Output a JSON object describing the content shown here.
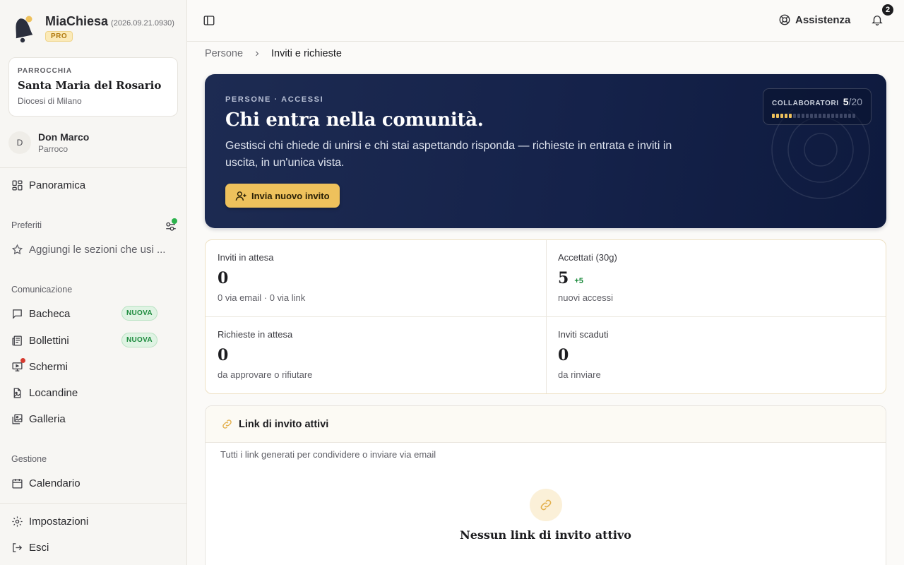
{
  "app": {
    "name": "MiaChiesa",
    "version": "(2026.09.21.0930)",
    "plan_badge": "PRO"
  },
  "parish": {
    "kicker": "PARROCCHIA",
    "name": "Santa Maria del Rosario",
    "diocese": "Diocesi di Milano"
  },
  "user": {
    "initial": "D",
    "name": "Don Marco",
    "role": "Parroco"
  },
  "sidebar": {
    "overview": "Panoramica",
    "favorites_label": "Preferiti",
    "favorites_hint": "Aggiungi le sezioni che usi ...",
    "communication_label": "Comunicazione",
    "communication": [
      {
        "label": "Bacheca",
        "badge": "NUOVA",
        "icon": "message-square-icon"
      },
      {
        "label": "Bollettini",
        "badge": "NUOVA",
        "icon": "newspaper-icon"
      },
      {
        "label": "Schermi",
        "icon": "monitor-icon"
      },
      {
        "label": "Locandine",
        "icon": "file-image-icon"
      },
      {
        "label": "Galleria",
        "icon": "images-icon"
      }
    ],
    "management_label": "Gestione",
    "calendar": "Calendario",
    "settings": "Impostazioni",
    "logout": "Esci"
  },
  "topbar": {
    "assist_label": "Assistenza",
    "notification_count": "2"
  },
  "breadcrumb": {
    "parent": "Persone",
    "current": "Inviti e richieste"
  },
  "hero": {
    "kicker": "PERSONE · ACCESSI",
    "title": "Chi entra nella comunità.",
    "description": "Gestisci chi chiede di unirsi e chi stai aspettando risponda — richieste in entrata e inviti in uscita, in un'unica vista.",
    "cta": "Invia nuovo invito",
    "collaborators_label": "COLLABORATORI",
    "collaborators_used": "5",
    "collaborators_total": "/20",
    "collaborators_fraction": 0.25
  },
  "stats": [
    {
      "label": "Inviti in attesa",
      "value": "0",
      "delta": "",
      "sub": "0 via email · 0 via link"
    },
    {
      "label": "Accettati (30g)",
      "value": "5",
      "delta": "+5",
      "sub": "nuovi accessi"
    },
    {
      "label": "Richieste in attesa",
      "value": "0",
      "delta": "",
      "sub": "da approvare o rifiutare"
    },
    {
      "label": "Inviti scaduti",
      "value": "0",
      "delta": "",
      "sub": "da rinviare"
    }
  ],
  "links_card": {
    "title": "Link di invito attivi",
    "subtitle": "Tutti i link generati per condividere o inviare via email",
    "empty_title": "Nessun link di invito attivo"
  },
  "colors": {
    "accent": "#eec15c",
    "hero_bg": "#15224a",
    "success": "#1b8a3c",
    "alert": "#d63a2f"
  }
}
